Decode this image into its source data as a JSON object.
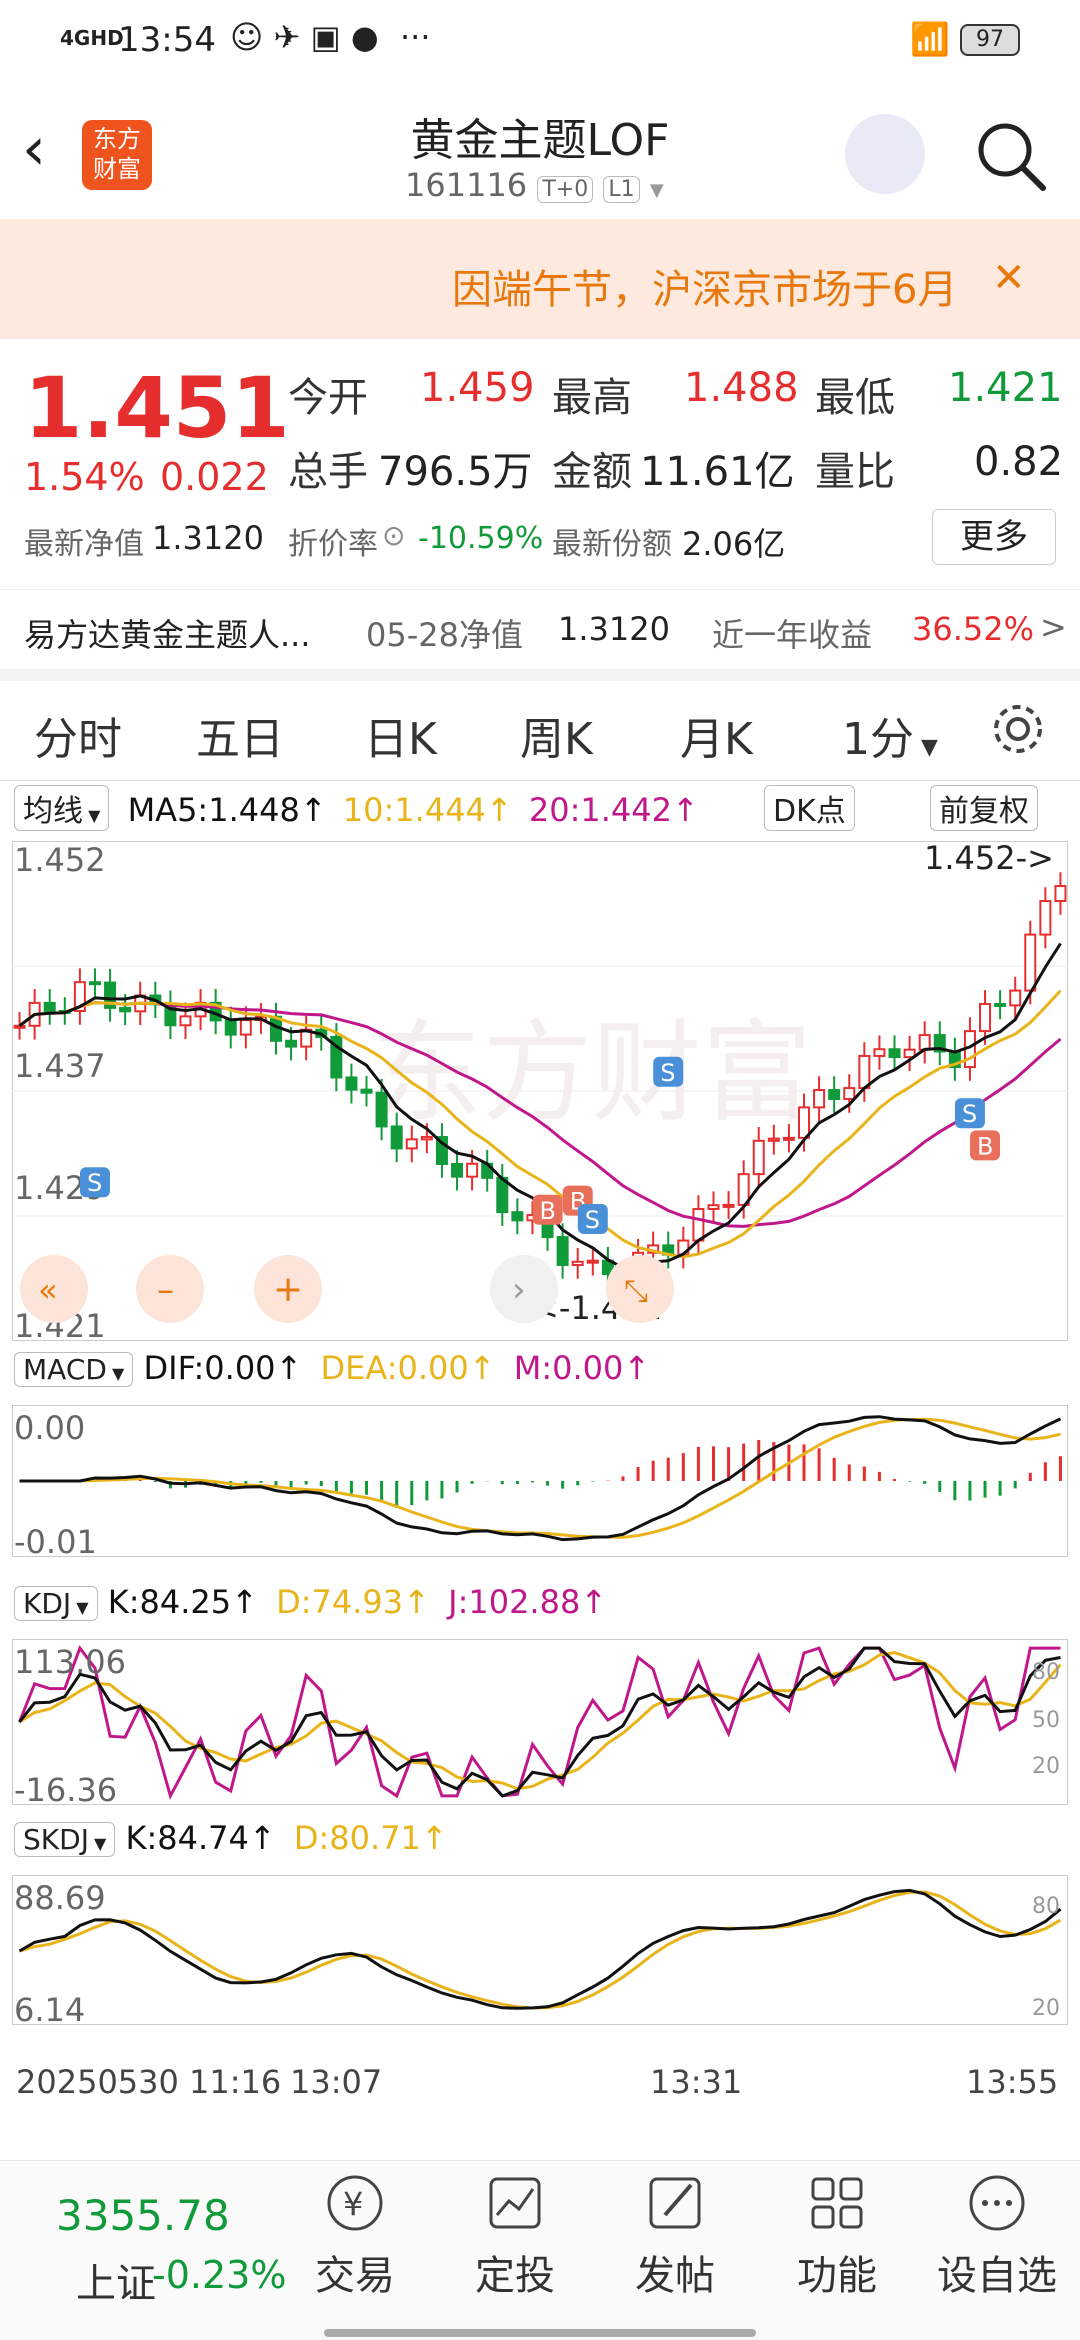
{
  "status": {
    "network": "4GHD",
    "time": "13:54",
    "battery": "97",
    "dots": "···"
  },
  "nav": {
    "logo": "东方财富",
    "title": "黄金主题LOF",
    "code": "161116",
    "badge1": "T+0",
    "badge2": "L1"
  },
  "notice": {
    "text": "因端午节，沪深京市场于6月",
    "close": "✕"
  },
  "quote": {
    "price": "1.451",
    "change_pct": "1.54%",
    "change": "0.022",
    "open_label": "今开",
    "open": "1.459",
    "high_label": "最高",
    "high": "1.488",
    "low_label": "最低",
    "low": "1.421",
    "vol_label": "总手",
    "vol": "796.5万",
    "amt_label": "金额",
    "amt": "11.61亿",
    "ratio_label": "量比",
    "ratio": "0.82",
    "nav_label": "最新净值",
    "nav": "1.3120",
    "disc_label": "折价率",
    "disc": "-10.59%",
    "share_label": "最新份额",
    "share": "2.06亿",
    "more": "更多"
  },
  "fund": {
    "name": "易方达黄金主题人...",
    "nav_date": "05-28净值",
    "nav_val": "1.3120",
    "yr_label": "近一年收益",
    "yr_val": "36.52%",
    "arrow": ">"
  },
  "tabs": [
    "分时",
    "五日",
    "日K",
    "周K",
    "月K",
    "1分"
  ],
  "ma": {
    "label": "均线",
    "ma5": "MA5:1.448↑",
    "ma10": "10:1.444↑",
    "ma20": "20:1.442↑",
    "dk": "DK点",
    "adj": "前复权"
  },
  "main_axis": [
    "1.452",
    "1.437",
    "1.429",
    "1.421"
  ],
  "main_marks": {
    "high": "1.452->",
    "low": "<-1.421"
  },
  "macd": {
    "label": "MACD",
    "dif": "DIF:0.00↑",
    "dea": "DEA:0.00↑",
    "m": "M:0.00↑",
    "top": "0.00",
    "bottom": "-0.01"
  },
  "kdj": {
    "label": "KDJ",
    "k": "K:84.25↑",
    "d": "D:74.93↑",
    "j": "J:102.88↑",
    "top": "113.06",
    "bottom": "-16.36",
    "r80": "80",
    "r50": "50",
    "r20": "20"
  },
  "skdj": {
    "label": "SKDJ",
    "k": "K:84.74↑",
    "d": "D:80.71↑",
    "top": "88.69",
    "bottom": "6.14",
    "r80": "80",
    "r20": "20"
  },
  "time_axis": [
    "20250530 11:16",
    "13:07",
    "13:31",
    "13:55"
  ],
  "bottom": {
    "index_value": "3355.78",
    "index_name": "上证",
    "index_change": "-0.23%",
    "items": [
      "交易",
      "定投",
      "发帖",
      "功能",
      "设自选"
    ]
  },
  "colors": {
    "up": "#e62e2e",
    "down": "#119a3a",
    "ma5": "#111111",
    "ma10": "#e8b41a",
    "ma20": "#c0188a",
    "accent": "#e8780c"
  }
}
